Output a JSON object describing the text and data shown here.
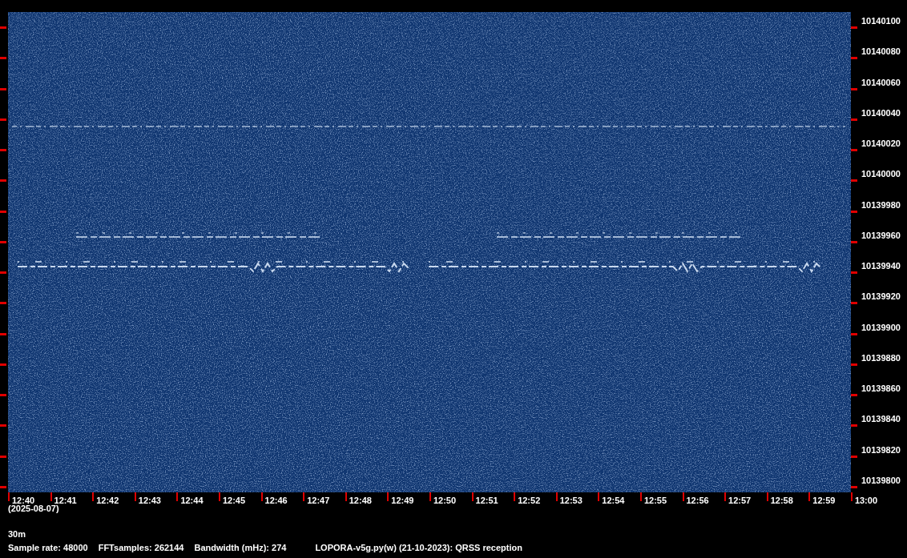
{
  "frequency_axis": {
    "labels": [
      "10140100",
      "10140080",
      "10140060",
      "10140040",
      "10140020",
      "10140000",
      "10139980",
      "10139960",
      "10139940",
      "10139920",
      "10139900",
      "10139880",
      "10139860",
      "10139840",
      "10139820",
      "10139800"
    ]
  },
  "time_axis": {
    "labels": [
      "12:40",
      "12:41",
      "12:42",
      "12:43",
      "12:44",
      "12:45",
      "12:46",
      "12:47",
      "12:48",
      "12:49",
      "12:50",
      "12:51",
      "12:52",
      "12:53",
      "12:54",
      "12:55",
      "12:56",
      "12:57",
      "12:58",
      "12:59",
      "13:00"
    ]
  },
  "date": "(2025-08-07)",
  "band": "30m",
  "info": [
    "Sample rate: 48000",
    "FFTsamples: 262144",
    "Bandwidth (mHz): 274",
    "LOPORA-v5g.py(w) (21-10-2023): QRSS reception"
  ]
}
